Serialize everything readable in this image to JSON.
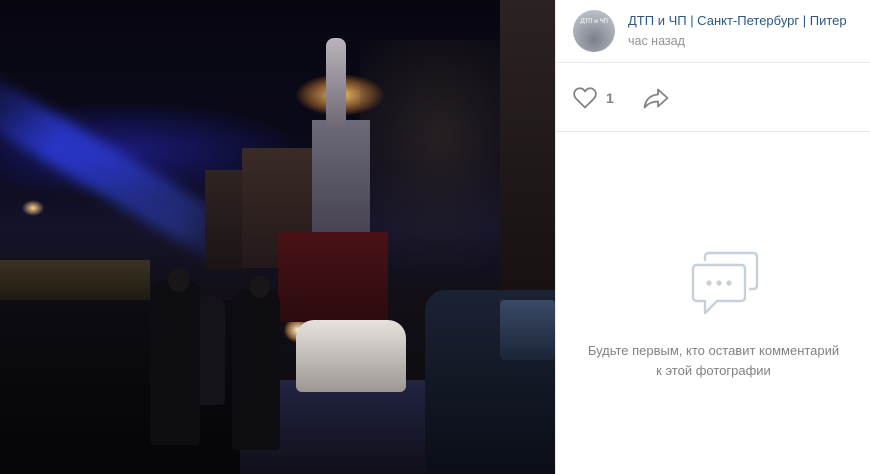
{
  "header": {
    "group_name": "ДТП и ЧП | Санкт-Петербург | Питер",
    "time": "час назад",
    "avatar_text": "ДТП и ЧП"
  },
  "actions": {
    "like_count": "1",
    "like_icon": "heart-outline-icon",
    "share_icon": "share-arrow-icon"
  },
  "comments": {
    "empty_icon": "comment-bubble-icon",
    "empty_text": "Будьте первым, кто оставит комментарий к этой фотографии"
  },
  "colors": {
    "link": "#2a5885",
    "muted": "#939393",
    "icon": "#828282",
    "empty_icon": "#c5d0db",
    "divider": "#e7e8ec"
  }
}
